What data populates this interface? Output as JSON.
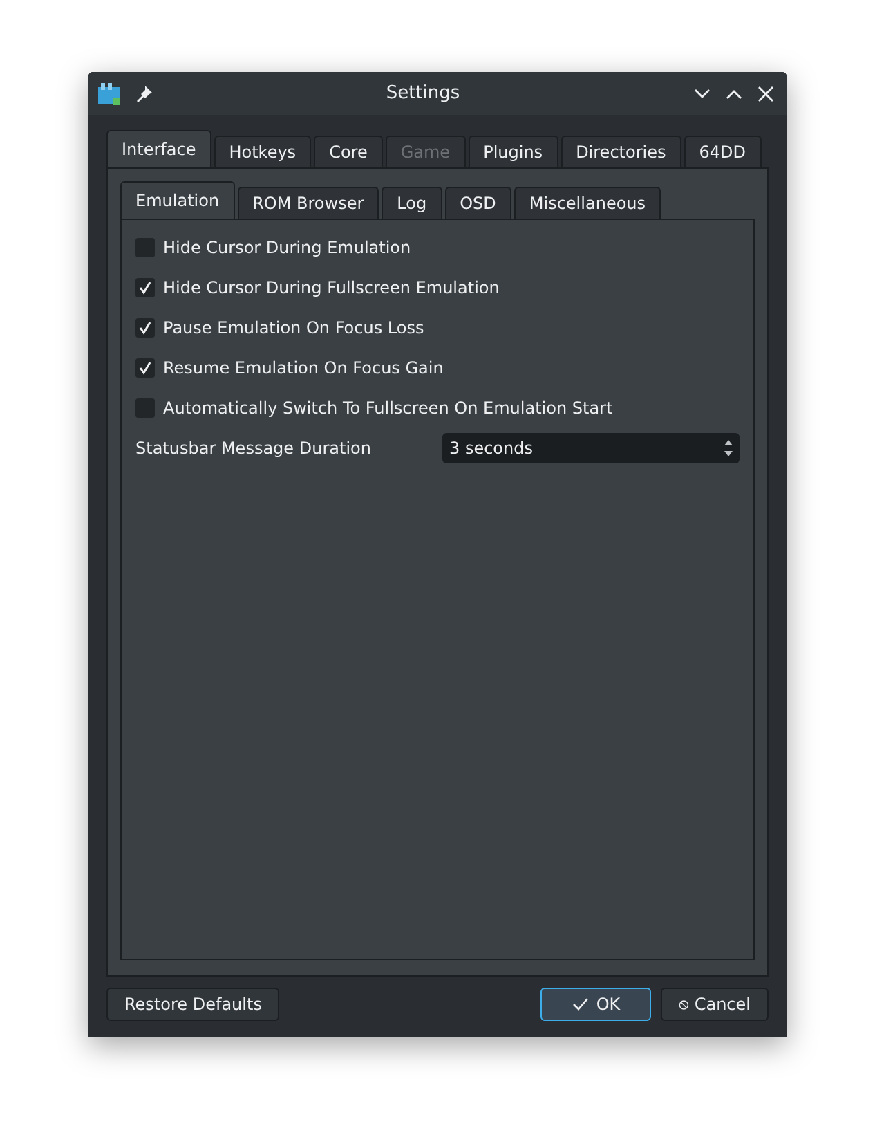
{
  "window": {
    "title": "Settings"
  },
  "tabs": [
    {
      "label": "Interface",
      "selected": true,
      "disabled": false
    },
    {
      "label": "Hotkeys",
      "selected": false,
      "disabled": false
    },
    {
      "label": "Core",
      "selected": false,
      "disabled": false
    },
    {
      "label": "Game",
      "selected": false,
      "disabled": true
    },
    {
      "label": "Plugins",
      "selected": false,
      "disabled": false
    },
    {
      "label": "Directories",
      "selected": false,
      "disabled": false
    },
    {
      "label": "64DD",
      "selected": false,
      "disabled": false
    }
  ],
  "subtabs": [
    {
      "label": "Emulation",
      "selected": true
    },
    {
      "label": "ROM Browser",
      "selected": false
    },
    {
      "label": "Log",
      "selected": false
    },
    {
      "label": "OSD",
      "selected": false
    },
    {
      "label": "Miscellaneous",
      "selected": false
    }
  ],
  "options": [
    {
      "label": "Hide Cursor During Emulation",
      "checked": false
    },
    {
      "label": "Hide Cursor During Fullscreen Emulation",
      "checked": true
    },
    {
      "label": "Pause Emulation On Focus Loss",
      "checked": true
    },
    {
      "label": "Resume Emulation On Focus Gain",
      "checked": true
    },
    {
      "label": "Automatically Switch To Fullscreen On Emulation Start",
      "checked": false
    }
  ],
  "statusbar_duration": {
    "label": "Statusbar Message Duration",
    "value": "3 seconds"
  },
  "buttons": {
    "restore": "Restore Defaults",
    "ok": "OK",
    "cancel": "Cancel"
  }
}
